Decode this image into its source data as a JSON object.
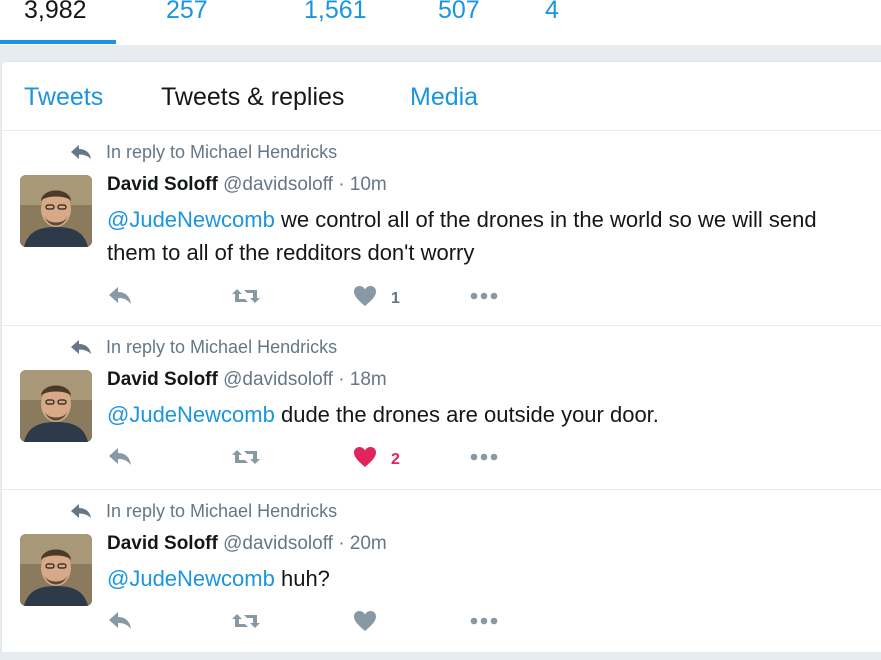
{
  "stats": [
    {
      "value": "3,982",
      "active": true
    },
    {
      "value": "257"
    },
    {
      "value": "1,561"
    },
    {
      "value": "507"
    },
    {
      "value": "4"
    }
  ],
  "tabs": [
    {
      "label": "Tweets",
      "state": "link"
    },
    {
      "label": "Tweets & replies",
      "state": "current"
    },
    {
      "label": "Media",
      "state": "link"
    }
  ],
  "colors": {
    "link": "#1b95e0",
    "like_active": "#e0245e",
    "muted": "#657786"
  },
  "tweets": [
    {
      "context": "In reply to Michael Hendricks",
      "fullname": "David Soloff",
      "screenname": "@davidsoloff",
      "dot": "·",
      "time": "10m",
      "mention": "@JudeNewcomb",
      "text": " we control all of the drones in the world so we will send them to all of the redditors don't worry",
      "likes": "1",
      "liked": false
    },
    {
      "context": "In reply to Michael Hendricks",
      "fullname": "David Soloff",
      "screenname": "@davidsoloff",
      "dot": "·",
      "time": "18m",
      "mention": "@JudeNewcomb",
      "text": " dude the drones are outside your door.",
      "likes": "2",
      "liked": true
    },
    {
      "context": "In reply to Michael Hendricks",
      "fullname": "David Soloff",
      "screenname": "@davidsoloff",
      "dot": "·",
      "time": "20m",
      "mention": "@JudeNewcomb",
      "text": " huh?",
      "likes": "",
      "liked": false
    }
  ]
}
